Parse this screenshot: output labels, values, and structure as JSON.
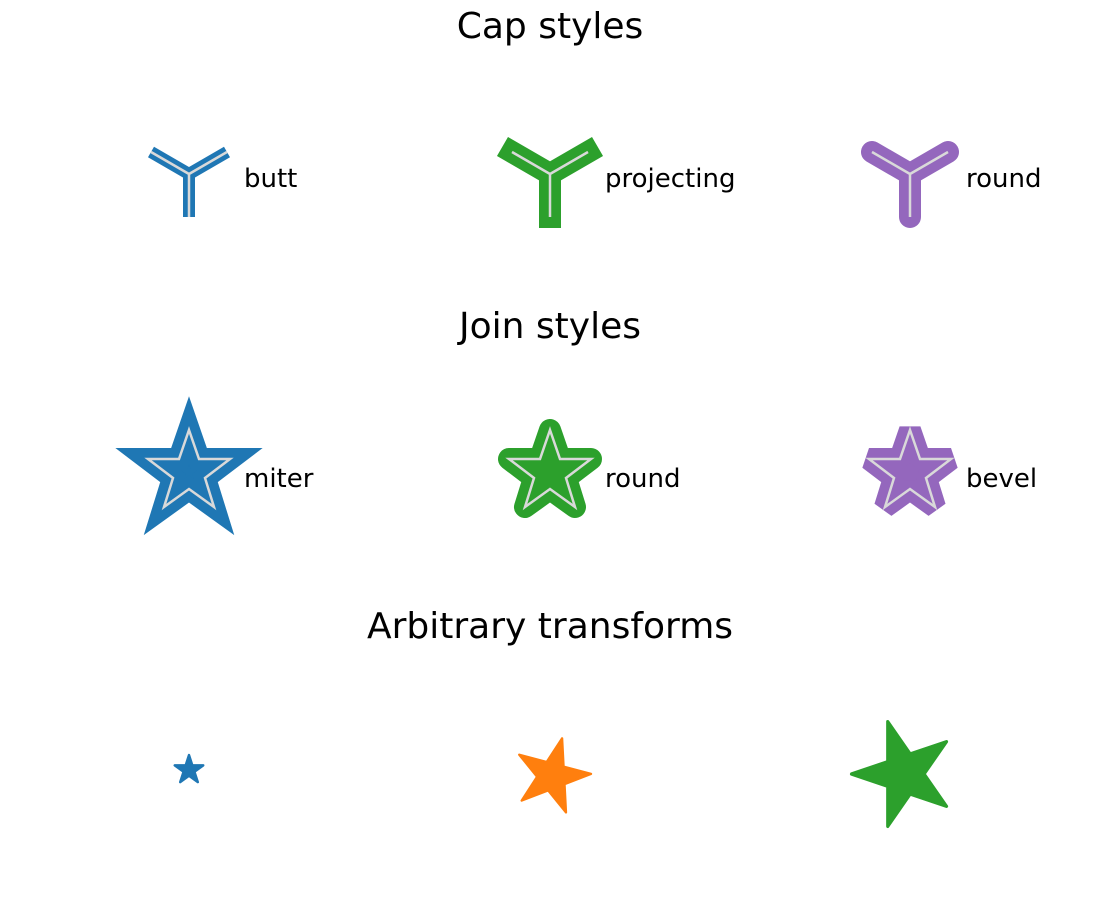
{
  "colors": {
    "blue": "#1f77b4",
    "orange": "#ff7f0e",
    "green": "#2ca02c",
    "purple": "#9467bd",
    "guide": "#d9d9d9",
    "background": "#ffffff"
  },
  "sections": {
    "cap": {
      "title": "Cap styles",
      "items": [
        {
          "label": "butt",
          "color": "blue",
          "marker": "tri-arm"
        },
        {
          "label": "projecting",
          "color": "green",
          "marker": "tri-arm"
        },
        {
          "label": "round",
          "color": "purple",
          "marker": "tri-arm"
        }
      ]
    },
    "join": {
      "title": "Join styles",
      "items": [
        {
          "label": "miter",
          "color": "blue",
          "marker": "star"
        },
        {
          "label": "round",
          "color": "green",
          "marker": "star"
        },
        {
          "label": "bevel",
          "color": "purple",
          "marker": "star"
        }
      ]
    },
    "transforms": {
      "title": "Arbitrary transforms",
      "items": [
        {
          "color": "blue",
          "marker": "star"
        },
        {
          "color": "orange",
          "marker": "star"
        },
        {
          "color": "green",
          "marker": "star"
        }
      ]
    }
  }
}
